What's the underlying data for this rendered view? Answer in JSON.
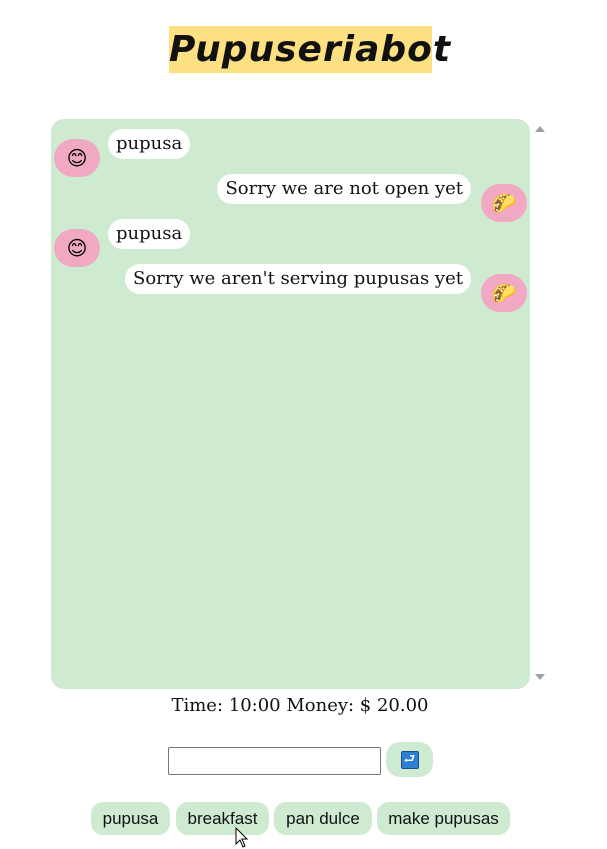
{
  "app": {
    "title": "Pupuseriabot"
  },
  "chat": {
    "messages": [
      {
        "sender": "user",
        "avatar_icon": "smiling-face-icon",
        "avatar_glyph": "😊",
        "text": "pupusa"
      },
      {
        "sender": "bot",
        "avatar_icon": "pupusa-icon",
        "avatar_glyph": "🌮",
        "text": "Sorry we are not open yet"
      },
      {
        "sender": "user",
        "avatar_icon": "smiling-face-icon",
        "avatar_glyph": "😊",
        "text": "pupusa"
      },
      {
        "sender": "bot",
        "avatar_icon": "pupusa-icon",
        "avatar_glyph": "🌮",
        "text": "Sorry we aren't serving pupusas yet"
      }
    ],
    "background_color": "#ceead0",
    "bot_avatar_color": "#f1a8c3"
  },
  "status": {
    "text": "Time: 10:00 Money: $ 20.00"
  },
  "input": {
    "value": "",
    "placeholder": ""
  },
  "send": {
    "icon": "return-arrow-icon",
    "glyph": "⮐"
  },
  "quick_replies": [
    "pupusa",
    "breakfast",
    "pan dulce",
    "make pupusas"
  ],
  "colors": {
    "title_highlight": "#fde081",
    "accent_green": "#ceead0"
  }
}
